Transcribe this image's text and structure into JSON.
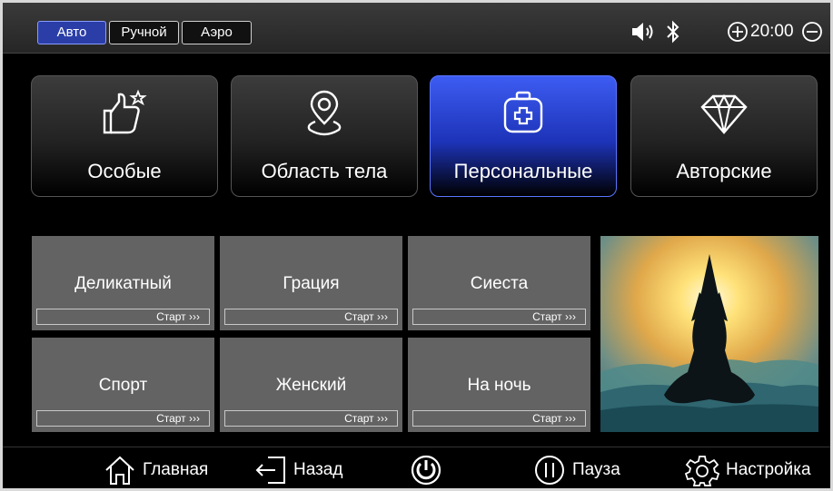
{
  "topbar": {
    "modes": [
      {
        "label": "Авто",
        "active": true
      },
      {
        "label": "Ручной",
        "active": false
      },
      {
        "label": "Аэро",
        "active": false
      }
    ],
    "icons": {
      "volume": "speaker-icon",
      "bluetooth": "bluetooth-icon",
      "plus": "plus-circle-icon",
      "minus": "minus-circle-icon"
    },
    "time": "20:00"
  },
  "categories": [
    {
      "label": "Особые",
      "icon": "thumbs-up-star-icon",
      "active": false
    },
    {
      "label": "Область тела",
      "icon": "location-pin-icon",
      "active": false
    },
    {
      "label": "Персональные",
      "icon": "medical-kit-icon",
      "active": true
    },
    {
      "label": "Авторские",
      "icon": "diamond-icon",
      "active": false
    }
  ],
  "programs": [
    {
      "name": "Деликатный",
      "start": "Старт ›››"
    },
    {
      "name": "Грация",
      "start": "Старт ›››"
    },
    {
      "name": "Сиеста",
      "start": "Старт ›››"
    },
    {
      "name": "Спорт",
      "start": "Старт ›››"
    },
    {
      "name": "Женский",
      "start": "Старт ›››"
    },
    {
      "name": "На ночь",
      "start": "Старт ›››"
    }
  ],
  "bottombar": {
    "home": "Главная",
    "back": "Назад",
    "pause": "Пауза",
    "settings": "Настройка"
  },
  "colors": {
    "accent": "#2b3ea8",
    "active_card": "#3d5cf2",
    "tile": "#636363"
  }
}
